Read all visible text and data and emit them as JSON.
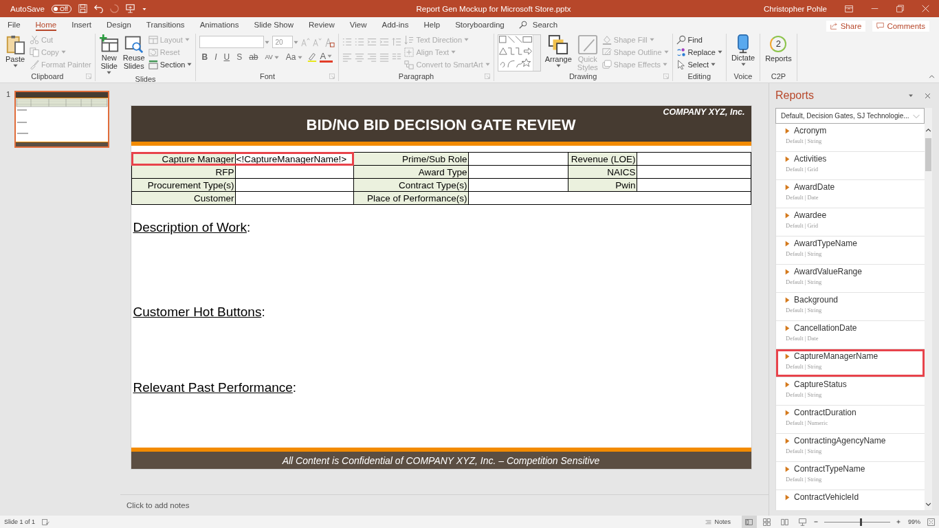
{
  "title_bar": {
    "autosave_label": "AutoSave",
    "autosave_state": "Off",
    "autosave_on": false,
    "document_title": "Report Gen Mockup for Microsoft Store.pptx",
    "user_name": "Christopher Pohle"
  },
  "tabs": [
    {
      "label": "File",
      "selected": false
    },
    {
      "label": "Home",
      "selected": true
    },
    {
      "label": "Insert",
      "selected": false
    },
    {
      "label": "Design",
      "selected": false
    },
    {
      "label": "Transitions",
      "selected": false
    },
    {
      "label": "Animations",
      "selected": false
    },
    {
      "label": "Slide Show",
      "selected": false
    },
    {
      "label": "Review",
      "selected": false
    },
    {
      "label": "View",
      "selected": false
    },
    {
      "label": "Add-ins",
      "selected": false
    },
    {
      "label": "Help",
      "selected": false
    },
    {
      "label": "Storyboarding",
      "selected": false
    }
  ],
  "search": {
    "placeholder": "Search"
  },
  "share_button": "Share",
  "comments_button": "Comments",
  "ribbon": {
    "groups": [
      {
        "kind": "clipboard",
        "name": "Clipboard",
        "launcher": true,
        "paste": {
          "label": "Paste",
          "disabled": false
        },
        "commands": [
          {
            "label": "Cut",
            "disabled": true
          },
          {
            "label": "Copy",
            "disabled": true
          },
          {
            "label": "Format Painter",
            "disabled": true
          }
        ]
      },
      {
        "kind": "slides",
        "name": "Slides",
        "launcher": false,
        "buttons": [
          {
            "label": "New Slide",
            "disabled": false
          },
          {
            "label": "Reuse Slides",
            "disabled": false
          }
        ],
        "commands": [
          {
            "label": "Layout",
            "disabled": true
          },
          {
            "label": "Reset",
            "disabled": true
          },
          {
            "label": "Section",
            "disabled": false
          }
        ]
      },
      {
        "kind": "font",
        "name": "Font",
        "launcher": true,
        "font_size": "20",
        "format_buttons": [
          "B",
          "I",
          "U",
          "S",
          "ab",
          "AV",
          "Aa"
        ],
        "font_color_label": "A"
      },
      {
        "kind": "paragraph",
        "name": "Paragraph",
        "launcher": true,
        "commands": [
          {
            "label": "Text Direction",
            "disabled": true
          },
          {
            "label": "Align Text",
            "disabled": true
          },
          {
            "label": "Convert to SmartArt",
            "disabled": true
          }
        ]
      },
      {
        "kind": "drawing",
        "name": "Drawing",
        "launcher": true,
        "arrange": {
          "label": "Arrange",
          "disabled": false
        },
        "quick_styles": {
          "label": "Quick Styles",
          "disabled": true
        },
        "commands": [
          {
            "label": "Shape Fill",
            "disabled": true
          },
          {
            "label": "Shape Outline",
            "disabled": true
          },
          {
            "label": "Shape Effects",
            "disabled": true
          }
        ]
      },
      {
        "kind": "editing",
        "name": "Editing",
        "launcher": false,
        "commands": [
          {
            "label": "Find",
            "disabled": false
          },
          {
            "label": "Replace",
            "disabled": false
          },
          {
            "label": "Select",
            "disabled": false
          }
        ]
      },
      {
        "kind": "voice",
        "name": "Voice",
        "launcher": false,
        "button": {
          "label": "Dictate",
          "disabled": false
        }
      },
      {
        "kind": "addin",
        "name": "C2P",
        "launcher": false,
        "button": {
          "label": "Reports",
          "disabled": false,
          "badge": "2"
        }
      }
    ]
  },
  "slides": [
    {
      "number": "1",
      "selected": true
    }
  ],
  "slide": {
    "company": "COMPANY XYZ, Inc.",
    "title": "BID/NO BID DECISION GATE REVIEW",
    "table": {
      "rows": [
        {
          "cells": [
            {
              "text": "Capture Manager",
              "kind": "label",
              "highlighted": true
            },
            {
              "text": "<!CaptureManagerName!>",
              "kind": "value",
              "highlighted": true
            },
            {
              "text": "Prime/Sub Role",
              "kind": "label",
              "highlighted": false
            },
            {
              "kind": "value",
              "highlighted": false
            },
            {
              "text": "Revenue (LOE)",
              "kind": "label",
              "highlighted": false
            },
            {
              "kind": "value",
              "highlighted": false
            }
          ]
        },
        {
          "cells": [
            {
              "text": "RFP",
              "kind": "label",
              "highlighted": false
            },
            {
              "kind": "value",
              "highlighted": false
            },
            {
              "text": "Award Type",
              "kind": "label",
              "highlighted": false
            },
            {
              "kind": "value",
              "highlighted": false
            },
            {
              "text": "NAICS",
              "kind": "label",
              "highlighted": false
            },
            {
              "kind": "value",
              "highlighted": false
            }
          ]
        },
        {
          "cells": [
            {
              "text": "Procurement Type(s)",
              "kind": "label",
              "highlighted": false
            },
            {
              "kind": "value",
              "highlighted": false
            },
            {
              "text": "Contract Type(s)",
              "kind": "label",
              "highlighted": false
            },
            {
              "kind": "value",
              "highlighted": false
            },
            {
              "text": "Pwin",
              "kind": "label",
              "highlighted": false
            },
            {
              "kind": "value",
              "highlighted": false
            }
          ]
        },
        {
          "cells": [
            {
              "text": "Customer",
              "kind": "label",
              "highlighted": false
            },
            {
              "kind": "value",
              "highlighted": false
            },
            {
              "text": "Place of Performance(s)",
              "kind": "label",
              "highlighted": false
            },
            {
              "kind": "wide-value",
              "highlighted": false
            }
          ]
        }
      ]
    },
    "sections": [
      {
        "title": "Description of Work",
        "suffix": ":"
      },
      {
        "title": "Customer Hot Buttons",
        "suffix": ":"
      },
      {
        "title": "Relevant Past Performance",
        "suffix": ":"
      }
    ],
    "footer": "All Content is Confidential of COMPANY XYZ, Inc. – Competition Sensitive"
  },
  "notes": {
    "placeholder": "Click to add notes"
  },
  "reports_pane": {
    "title": "Reports",
    "filter": "Default, Decision Gates, SJ Technologie...",
    "fields": [
      {
        "name": "Acronym",
        "meta": "Default | String",
        "highlighted": false
      },
      {
        "name": "Activities",
        "meta": "Default | Grid",
        "highlighted": false
      },
      {
        "name": "AwardDate",
        "meta": "Default | Date",
        "highlighted": false
      },
      {
        "name": "Awardee",
        "meta": "Default | Grid",
        "highlighted": false
      },
      {
        "name": "AwardTypeName",
        "meta": "Default | String",
        "highlighted": false
      },
      {
        "name": "AwardValueRange",
        "meta": "Default | String",
        "highlighted": false
      },
      {
        "name": "Background",
        "meta": "Default | String",
        "highlighted": false
      },
      {
        "name": "CancellationDate",
        "meta": "Default | Date",
        "highlighted": false
      },
      {
        "name": "CaptureManagerName",
        "meta": "Default | String",
        "highlighted": true
      },
      {
        "name": "CaptureStatus",
        "meta": "Default | String",
        "highlighted": false
      },
      {
        "name": "ContractDuration",
        "meta": "Default | Numeric",
        "highlighted": false
      },
      {
        "name": "ContractingAgencyName",
        "meta": "Default | String",
        "highlighted": false
      },
      {
        "name": "ContractTypeName",
        "meta": "Default | String",
        "highlighted": false
      },
      {
        "name": "ContractVehicleId",
        "highlighted": false
      }
    ]
  },
  "status_bar": {
    "slide_info": "Slide 1 of 1",
    "notes_label": "Notes",
    "views": [
      {
        "selected": true
      },
      {
        "selected": false
      },
      {
        "selected": false
      },
      {
        "selected": false
      }
    ],
    "zoom": {
      "level": 0.55,
      "reading": "99%"
    }
  }
}
